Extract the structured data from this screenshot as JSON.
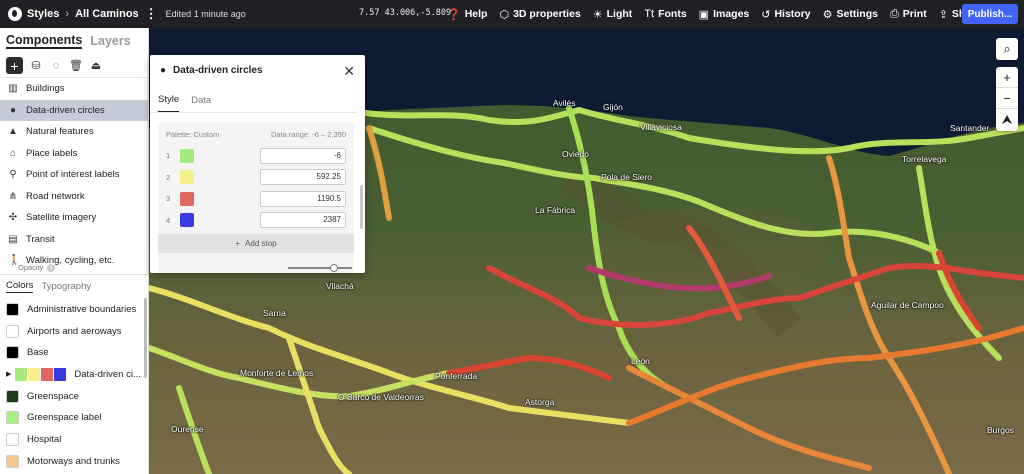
{
  "header": {
    "styles_label": "Styles",
    "project_name": "All Caminos",
    "edited": "Edited 1 minute ago",
    "coords": "7.57 43.006,-5.809",
    "items": [
      {
        "label": "Help",
        "icon": "help-icon"
      },
      {
        "label": "3D properties",
        "icon": "cube-icon"
      },
      {
        "label": "Light",
        "icon": "sun-icon"
      },
      {
        "label": "Fonts",
        "icon": "fonts-icon"
      },
      {
        "label": "Images",
        "icon": "image-icon"
      },
      {
        "label": "History",
        "icon": "history-icon"
      },
      {
        "label": "Settings",
        "icon": "gear-icon"
      },
      {
        "label": "Print",
        "icon": "print-icon"
      },
      {
        "label": "Share...",
        "icon": "share-icon"
      }
    ],
    "publish_label": "Publish..."
  },
  "sidebar": {
    "tabs": [
      "Components",
      "Layers"
    ],
    "layers": [
      {
        "label": "Buildings",
        "icon": "building-icon"
      },
      {
        "label": "Data-driven circles",
        "icon": "circles-icon"
      },
      {
        "label": "Natural features",
        "icon": "mountain-icon"
      },
      {
        "label": "Place labels",
        "icon": "place-label-icon"
      },
      {
        "label": "Point of interest labels",
        "icon": "pin-icon"
      },
      {
        "label": "Road network",
        "icon": "road-network-icon"
      },
      {
        "label": "Satellite imagery",
        "icon": "satellite-icon"
      },
      {
        "label": "Transit",
        "icon": "transit-icon"
      },
      {
        "label": "Walking, cycling, etc.",
        "icon": "walking-icon"
      }
    ],
    "sub_tabs": [
      "Colors",
      "Typography"
    ],
    "colors": [
      {
        "label": "Administrative boundaries",
        "color": "#000000"
      },
      {
        "label": "Airports and aeroways",
        "color": "#ffffff"
      },
      {
        "label": "Base",
        "color": "#000000"
      },
      {
        "label": "Data-driven ci...",
        "multi": [
          "#a4ea7f",
          "#f5f08a",
          "#e0675f",
          "#3b3ae0"
        ]
      },
      {
        "label": "Greenspace",
        "color": "#1b3d17"
      },
      {
        "label": "Greenspace label",
        "color": "#a7f27b"
      },
      {
        "label": "Hospital",
        "color": "#ffffff"
      },
      {
        "label": "Motorways and trunks",
        "color": "#f4c58e"
      }
    ]
  },
  "panel": {
    "title": "Data-driven circles",
    "tabs": [
      "Style",
      "Data"
    ],
    "palette_label": "Palette: Custom",
    "data_range": "Data range: -6 – 2,390",
    "stops": [
      {
        "index": "1",
        "color": "#a4ea7f",
        "value": "-6"
      },
      {
        "index": "2",
        "color": "#f5f08a",
        "value": "592.25"
      },
      {
        "index": "3",
        "color": "#e0675f",
        "value": "1190.5"
      },
      {
        "index": "4",
        "color": "#3b3ae0",
        "value": "2387"
      }
    ],
    "add_stop": "Add stop",
    "opacity_label": "Opacity",
    "opacity_value": 0.72
  },
  "map": {
    "places": [
      "Avilés",
      "Gijón",
      "Villaviciosa",
      "Oviedo",
      "Pola de Siero",
      "Santander",
      "Torrelavega",
      "La Fábrica",
      "Vilachá",
      "Sarria",
      "Monforte de Lemos",
      "O Barco de Valdeorras",
      "Ponferrada",
      "Astorga",
      "León",
      "Ourense",
      "Aguilar de Campoo",
      "Burgos"
    ]
  }
}
